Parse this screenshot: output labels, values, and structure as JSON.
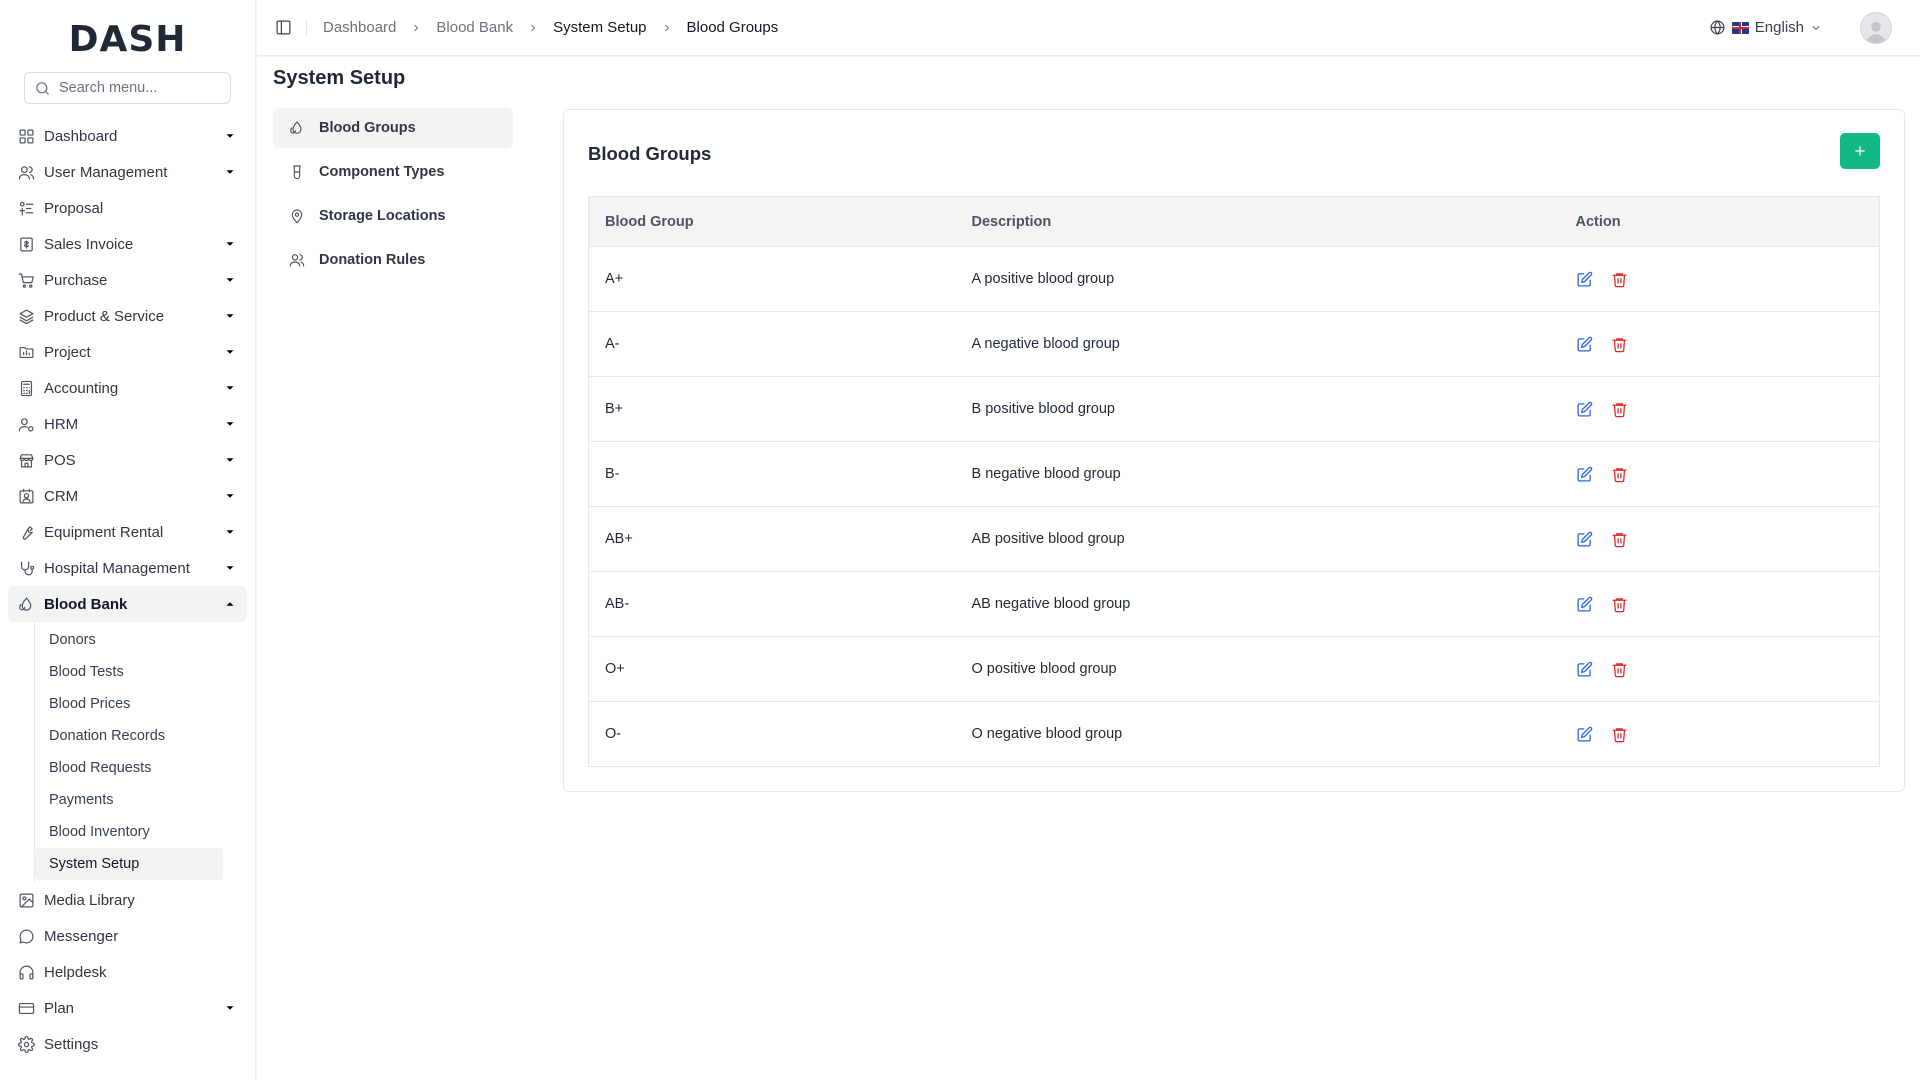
{
  "sidebar": {
    "logo": "DASH",
    "search_placeholder": "Search menu...",
    "items": [
      {
        "label": "Dashboard",
        "icon": "grid-icon",
        "chevron": true
      },
      {
        "label": "User Management",
        "icon": "users-icon",
        "chevron": true
      },
      {
        "label": "Proposal",
        "icon": "proposal-icon",
        "chevron": false
      },
      {
        "label": "Sales Invoice",
        "icon": "invoice-icon",
        "chevron": true
      },
      {
        "label": "Purchase",
        "icon": "cart-icon",
        "chevron": true
      },
      {
        "label": "Product & Service",
        "icon": "layers-icon",
        "chevron": true
      },
      {
        "label": "Project",
        "icon": "folder-icon",
        "chevron": true
      },
      {
        "label": "Accounting",
        "icon": "calculator-icon",
        "chevron": true
      },
      {
        "label": "HRM",
        "icon": "user-cog-icon",
        "chevron": true
      },
      {
        "label": "POS",
        "icon": "store-icon",
        "chevron": true
      },
      {
        "label": "CRM",
        "icon": "contact-icon",
        "chevron": true
      },
      {
        "label": "Equipment Rental",
        "icon": "wrench-icon",
        "chevron": true
      },
      {
        "label": "Hospital Management",
        "icon": "stethoscope-icon",
        "chevron": true
      },
      {
        "label": "Blood Bank",
        "icon": "blood-drop-icon",
        "chevron": true,
        "expanded": true
      }
    ],
    "blood_bank_sub": [
      "Donors",
      "Blood Tests",
      "Blood Prices",
      "Donation Records",
      "Blood Requests",
      "Payments",
      "Blood Inventory",
      "System Setup"
    ],
    "active_sub": "System Setup",
    "bottom_items": [
      {
        "label": "Media Library",
        "icon": "image-icon",
        "chevron": false
      },
      {
        "label": "Messenger",
        "icon": "message-icon",
        "chevron": false
      },
      {
        "label": "Helpdesk",
        "icon": "headphones-icon",
        "chevron": false
      },
      {
        "label": "Plan",
        "icon": "credit-card-icon",
        "chevron": true
      },
      {
        "label": "Settings",
        "icon": "gear-icon",
        "chevron": false
      }
    ]
  },
  "header": {
    "breadcrumb": [
      "Dashboard",
      "Blood Bank",
      "System Setup",
      "Blood Groups"
    ],
    "language": "English"
  },
  "main": {
    "page_title": "System Setup",
    "setup_menu": [
      {
        "label": "Blood Groups",
        "icon": "blood-drop-icon",
        "active": true
      },
      {
        "label": "Component Types",
        "icon": "test-tube-icon",
        "active": false
      },
      {
        "label": "Storage Locations",
        "icon": "map-pin-icon",
        "active": false
      },
      {
        "label": "Donation Rules",
        "icon": "users-icon",
        "active": false
      }
    ],
    "card": {
      "title": "Blood Groups",
      "add_label": "+",
      "columns": [
        "Blood Group",
        "Description",
        "Action"
      ],
      "rows": [
        {
          "group": "A+",
          "description": "A positive blood group"
        },
        {
          "group": "A-",
          "description": "A negative blood group"
        },
        {
          "group": "B+",
          "description": "B positive blood group"
        },
        {
          "group": "B-",
          "description": "B negative blood group"
        },
        {
          "group": "AB+",
          "description": "AB positive blood group"
        },
        {
          "group": "AB-",
          "description": "AB negative blood group"
        },
        {
          "group": "O+",
          "description": "O positive blood group"
        },
        {
          "group": "O-",
          "description": "O negative blood group"
        }
      ]
    }
  },
  "colors": {
    "accent": "#12b886",
    "edit": "#2563eb",
    "delete": "#dc2626"
  }
}
